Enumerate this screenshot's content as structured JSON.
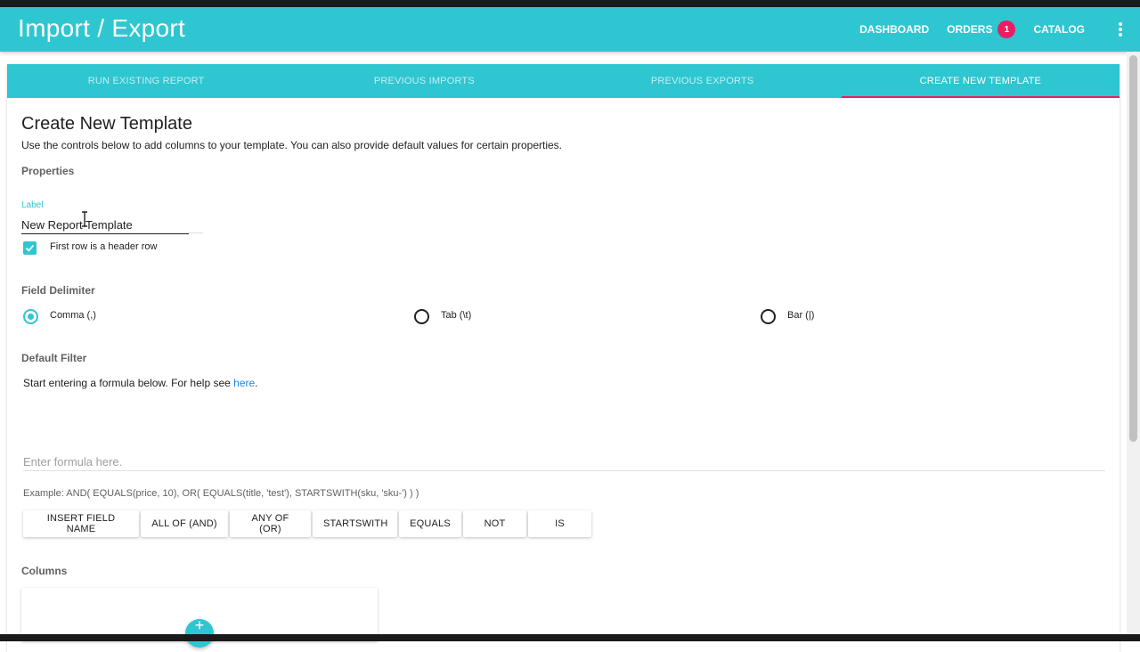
{
  "app": {
    "title": "Import / Export"
  },
  "nav": {
    "dashboard": "DASHBOARD",
    "orders": "ORDERS",
    "orders_badge": "1",
    "catalog": "CATALOG",
    "menu_icon": "more-vert-icon"
  },
  "tabs": [
    {
      "label": "RUN EXISTING REPORT",
      "active": false
    },
    {
      "label": "PREVIOUS IMPORTS",
      "active": false
    },
    {
      "label": "PREVIOUS EXPORTS",
      "active": false
    },
    {
      "label": "CREATE NEW TEMPLATE",
      "active": true
    }
  ],
  "page": {
    "title": "Create New Template",
    "description": "Use the controls below to add columns to your template. You can also provide default values for certain properties."
  },
  "properties": {
    "heading": "Properties",
    "label_field": {
      "label": "Label",
      "value": "New Report Template"
    },
    "header_row": {
      "label": "First row is a header row",
      "checked": true
    }
  },
  "delimiter": {
    "heading": "Field Delimiter",
    "options": [
      {
        "label": "Comma (,)",
        "checked": true
      },
      {
        "label": "Tab (\\t)",
        "checked": false
      },
      {
        "label": "Bar (|)",
        "checked": false
      }
    ]
  },
  "filter": {
    "heading": "Default Filter",
    "help_prefix": "Start entering a formula below. For help see ",
    "help_link": "here",
    "help_suffix": ".",
    "placeholder": "Enter formula here.",
    "example": "Example: AND( EQUALS(price, 10), OR( EQUALS(title, 'test'), STARTSWITH(sku, 'sku-') ) )",
    "buttons": [
      "INSERT FIELD NAME",
      "ALL OF (AND)",
      "ANY OF (OR)",
      "STARTSWITH",
      "EQUALS",
      "NOT",
      "IS"
    ]
  },
  "columns": {
    "heading": "Columns",
    "add_icon": "+"
  },
  "colors": {
    "primary": "#2ec6d1",
    "accent": "#e91e63",
    "link": "#1e88e5"
  }
}
